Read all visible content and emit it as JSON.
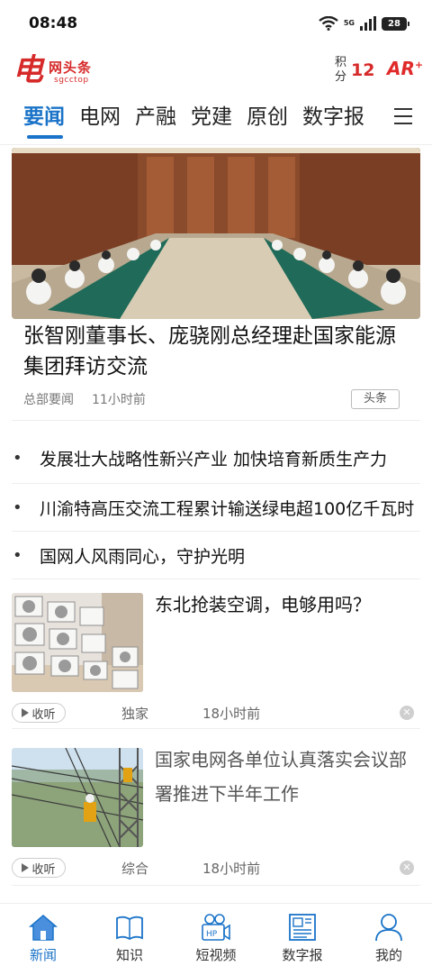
{
  "status_bar": {
    "time": "08:48",
    "network": "5G",
    "battery": "28"
  },
  "header": {
    "logo_mark": "电",
    "logo_name": "网头条",
    "logo_sub": "sgcctop",
    "points_label": "积分",
    "points_value": "12",
    "ar_label": "AR",
    "ar_plus": "+"
  },
  "tabs": [
    "要闻",
    "电网",
    "产融",
    "党建",
    "原创",
    "数字报"
  ],
  "active_tab": "要闻",
  "hero": {
    "title": "张智刚董事长、庞骁刚总经理赴国家能源集团拜访交流",
    "source": "总部要闻",
    "time": "11小时前",
    "tag": "头条"
  },
  "bullets": [
    "发展壮大战略性新兴产业 加快培育新质生产力",
    "川渝特高压交流工程累计输送绿电超100亿千瓦时",
    "国网人风雨同心，守护光明"
  ],
  "cards": [
    {
      "title": "东北抢装空调，电够用吗？",
      "listen": "收听",
      "source": "独家",
      "time": "18小时前"
    },
    {
      "title": "国家电网各单位认真落实会议部署推进下半年工作",
      "listen": "收听",
      "source": "综合",
      "time": "18小时前"
    }
  ],
  "bottom_nav": [
    {
      "label": "新闻",
      "icon": "home-icon"
    },
    {
      "label": "知识",
      "icon": "book-icon"
    },
    {
      "label": "短视频",
      "icon": "video-camera-icon"
    },
    {
      "label": "数字报",
      "icon": "newspaper-icon"
    },
    {
      "label": "我的",
      "icon": "person-icon"
    }
  ],
  "colors": {
    "accent": "#1a73c8",
    "brand_red": "#d62a2a",
    "text": "#111111",
    "meta": "#777777"
  }
}
